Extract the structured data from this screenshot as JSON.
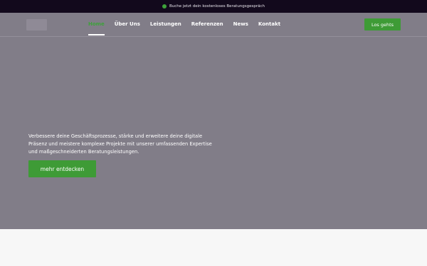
{
  "announcement": {
    "text": "Buche jetzt dein kostenloses Beratungsgespräch"
  },
  "nav": {
    "items": [
      {
        "label": "Home",
        "active": true
      },
      {
        "label": "Über Uns",
        "active": false
      },
      {
        "label": "Leistungen",
        "active": false
      },
      {
        "label": "Referenzen",
        "active": false
      },
      {
        "label": "News",
        "active": false
      },
      {
        "label": "Kontakt",
        "active": false
      }
    ],
    "cta_label": "Los gehts"
  },
  "hero": {
    "text": "Verbessere deine Geschäftsprozesse, stärke und erweitere deine digitale Präsenz und meistere komplexe Projekte mit unserer umfassenden Expertise und maßgeschneiderten Beratungsleistungen.",
    "button_label": "mehr entdecken"
  },
  "colors": {
    "accent": "#3e9b36",
    "topbar": "#12091c",
    "hero_overlay": "#817d88",
    "footer": "#f7f7f7"
  },
  "icons": {
    "announcement": "green-dot-icon"
  }
}
